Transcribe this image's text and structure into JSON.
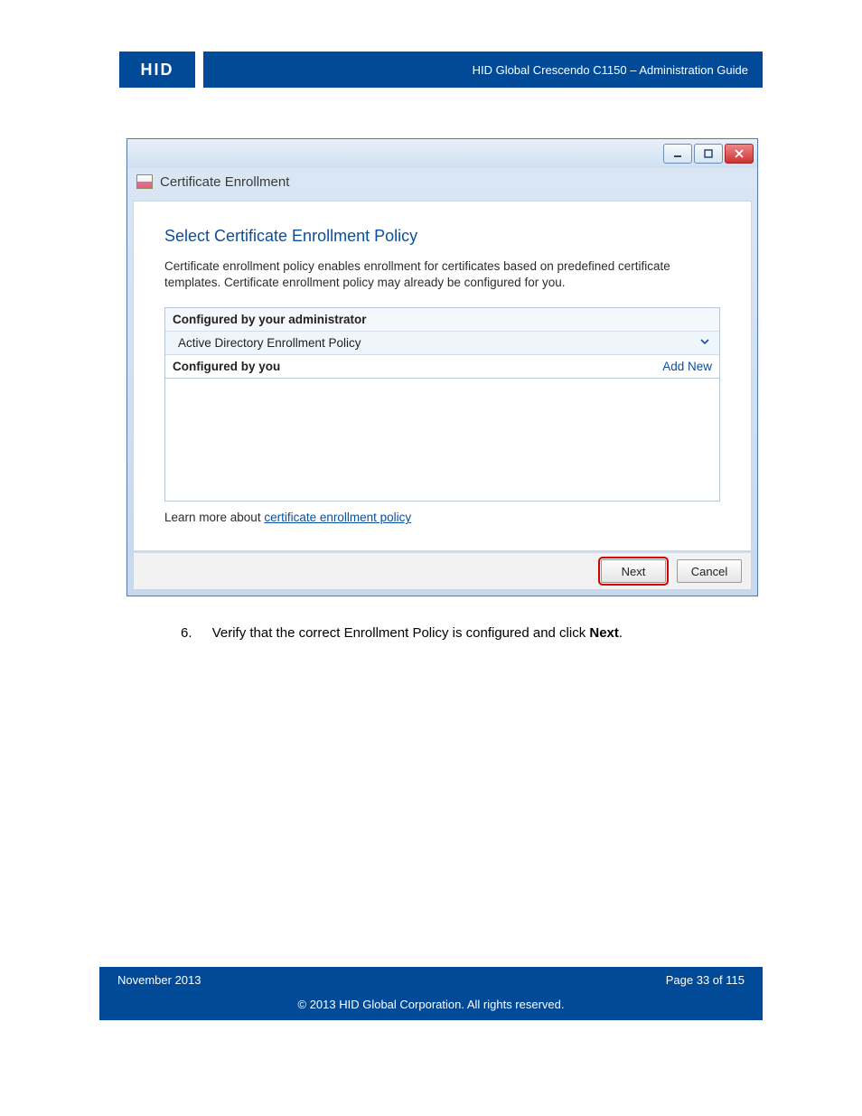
{
  "header": {
    "logo": "HID",
    "title": "HID Global Crescendo C1150  – Administration Guide"
  },
  "window": {
    "title": "Certificate Enrollment",
    "heading": "Select Certificate Enrollment Policy",
    "description": "Certificate enrollment policy enables enrollment for certificates based on predefined certificate templates. Certificate enrollment policy may already be configured for you.",
    "section_admin": "Configured by your administrator",
    "policy_item": "Active Directory Enrollment Policy",
    "section_you": "Configured by you",
    "add_new": "Add New",
    "learn_prefix": "Learn more about ",
    "learn_link": "certificate enrollment policy",
    "next_btn": "Next",
    "cancel_btn": "Cancel"
  },
  "instruction": {
    "number": "6.",
    "text_before": "Verify that the correct Enrollment Policy is configured and click ",
    "bold": "Next",
    "text_after": "."
  },
  "footer": {
    "date": "November 2013",
    "page": "Page 33 of 115",
    "copyright": "© 2013 HID Global Corporation. All rights reserved."
  }
}
